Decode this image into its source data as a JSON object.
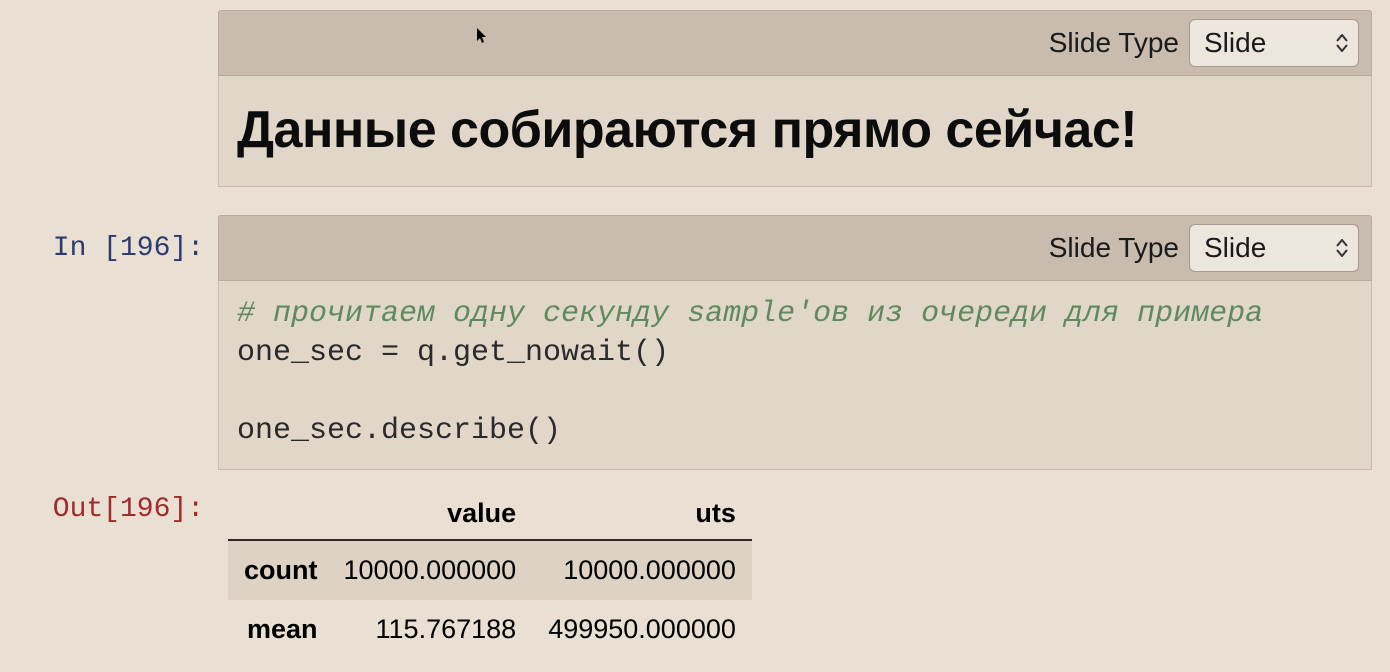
{
  "cells": [
    {
      "toolbar": {
        "label": "Slide Type",
        "selected": "Slide"
      },
      "markdown_heading": "Данные собираются прямо сейчас!"
    },
    {
      "prompt_in": "In [196]:",
      "toolbar": {
        "label": "Slide Type",
        "selected": "Slide"
      },
      "code": {
        "comment": "# прочитаем одну секунду sample'ов из очереди для примера",
        "line2": "one_sec = q.get_nowait()",
        "line3": "",
        "line4": "one_sec.describe()"
      }
    },
    {
      "prompt_out": "Out[196]:",
      "table": {
        "columns": [
          "value",
          "uts"
        ],
        "rows": [
          {
            "label": "count",
            "values": [
              "10000.000000",
              "10000.000000"
            ]
          },
          {
            "label": "mean",
            "values": [
              "115.767188",
              "499950.000000"
            ]
          }
        ]
      }
    }
  ]
}
